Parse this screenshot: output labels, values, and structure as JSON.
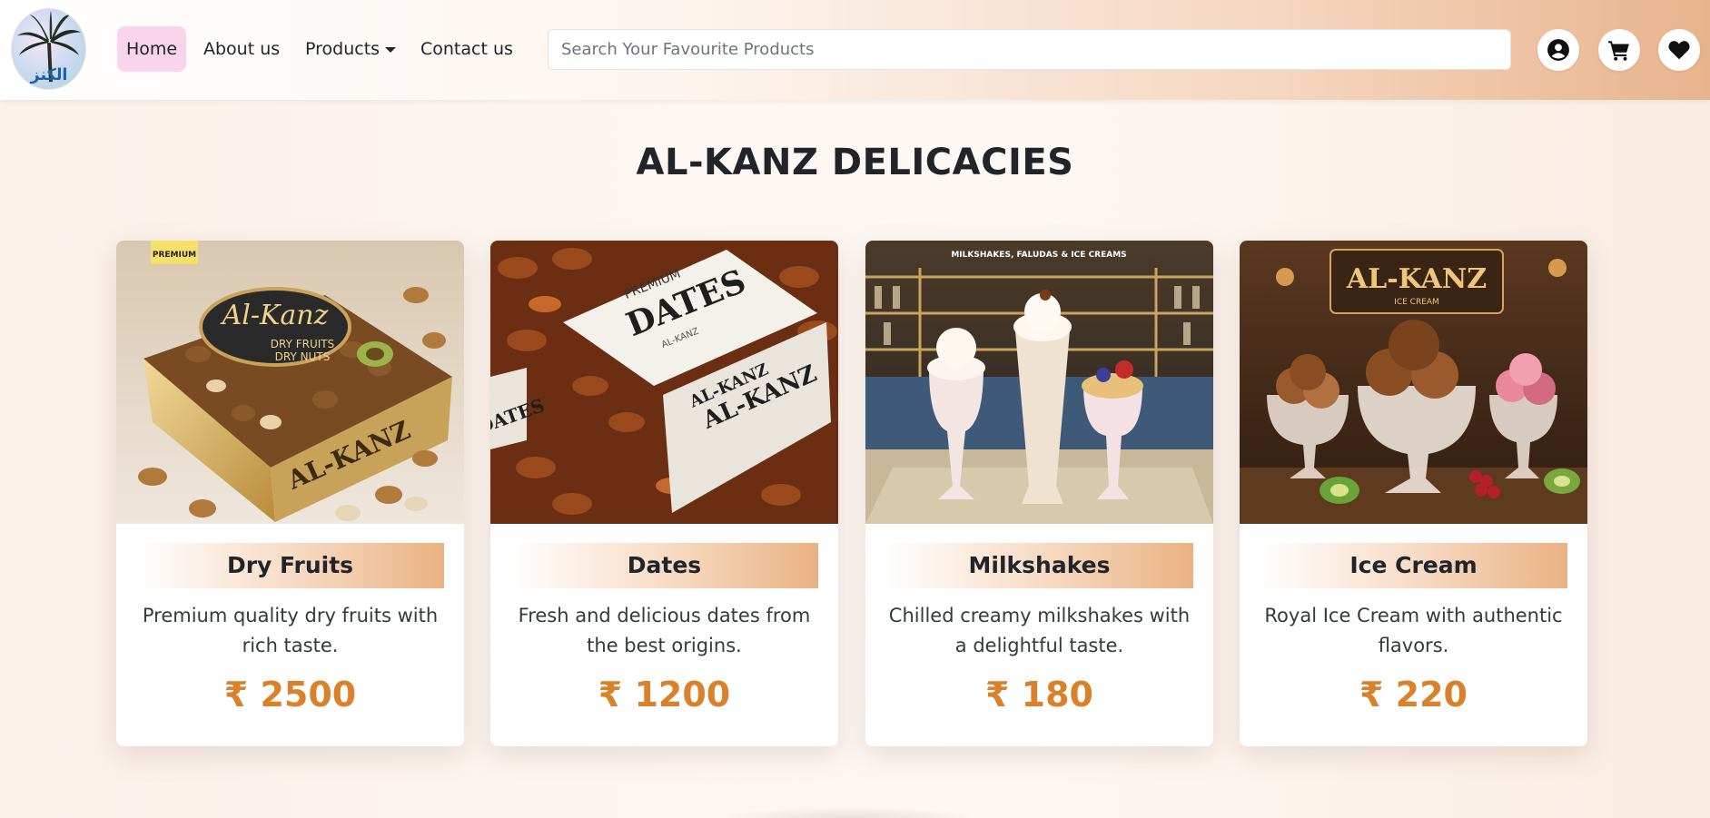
{
  "nav": {
    "home": "Home",
    "about": "About us",
    "products": "Products",
    "contact": "Contact us"
  },
  "search": {
    "placeholder": "Search Your Favourite Products"
  },
  "icons": {
    "user": "user-circle-icon",
    "cart": "cart-icon",
    "wishlist": "heart-icon"
  },
  "page": {
    "title": "AL-KANZ DELICACIES"
  },
  "products": [
    {
      "name": "Dry Fruits",
      "description": "Premium quality dry fruits with rich taste.",
      "price": "₹ 2500",
      "image_text": "Al-Kanz Dry Fruits Dry Nuts"
    },
    {
      "name": "Dates",
      "description": "Fresh and delicious dates from the best origins.",
      "price": "₹ 1200",
      "image_text": "Premium Dates Al-Kanz"
    },
    {
      "name": "Milkshakes",
      "description": "Chilled creamy milkshakes with a delightful taste.",
      "price": "₹ 180",
      "image_text": "Milkshakes, Faludas & Ice Creams"
    },
    {
      "name": "Ice Cream",
      "description": "Royal Ice Cream with authentic flavors.",
      "price": "₹ 220",
      "image_text": "Al-Kanz Ice Cream"
    }
  ],
  "colors": {
    "accent": "#d9822b",
    "nav_active": "#f9d4ea",
    "nav_gradient_end": "#e8b48d"
  }
}
